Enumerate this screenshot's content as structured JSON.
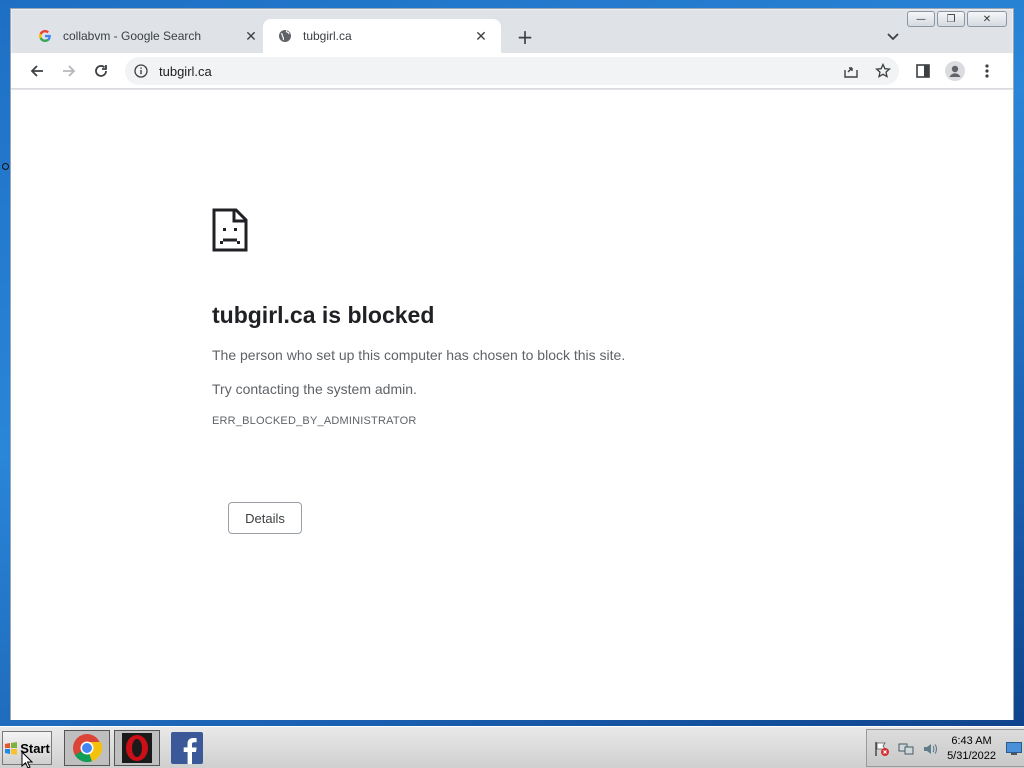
{
  "browser": {
    "window_controls": {
      "minimize": "—",
      "restore": "❐",
      "close": "✕"
    },
    "tabs": [
      {
        "title": "collabvm - Google Search",
        "favicon": "google-icon",
        "close": "✕"
      },
      {
        "title": "tubgirl.ca",
        "favicon": "globe-icon",
        "close": "✕"
      }
    ],
    "new_tab": "+",
    "address": {
      "url": "tubgirl.ca"
    }
  },
  "error_page": {
    "heading": "tubgirl.ca is blocked",
    "message": "The person who set up this computer has chosen to block this site.",
    "suggestion": "Try contacting the system admin.",
    "error_code": "ERR_BLOCKED_BY_ADMINISTRATOR",
    "details_button": "Details"
  },
  "taskbar": {
    "start_label": "Start",
    "pinned_apps": [
      "chrome-icon",
      "opera-icon",
      "facebook-icon"
    ],
    "clock": {
      "time": "6:43 AM",
      "date": "5/31/2022"
    }
  },
  "colors": {
    "accent_blue": "#1a73e8",
    "text_primary": "#202124",
    "text_secondary": "#5f6368",
    "opera_red": "#cc0f16",
    "facebook_blue": "#3b5998"
  }
}
